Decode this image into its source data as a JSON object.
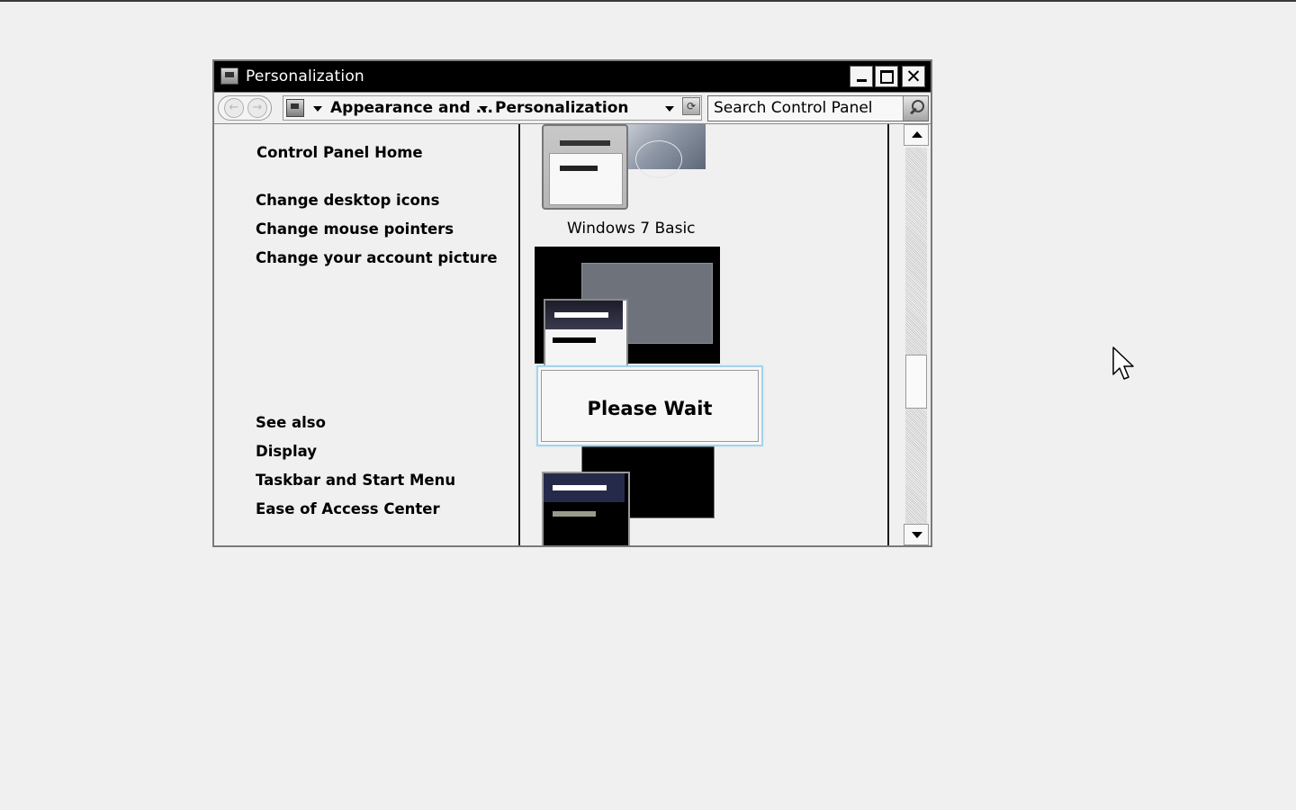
{
  "window": {
    "title": "Personalization"
  },
  "address_bar": {
    "breadcrumb": [
      "Appearance and ...",
      "Personalization"
    ],
    "search_placeholder": "Search Control Panel"
  },
  "left_pane": {
    "home_link": "Control Panel Home",
    "task_links": [
      "Change desktop icons",
      "Change mouse pointers",
      "Change your account picture"
    ],
    "see_also_heading": "See also",
    "see_also_links": [
      "Display",
      "Taskbar and Start Menu",
      "Ease of Access Center"
    ]
  },
  "themes": {
    "visible_label": "Windows 7 Basic"
  },
  "dialog": {
    "message": "Please Wait"
  },
  "colors": {
    "titlebar": "#000000",
    "window_bg": "#f0f0f0",
    "dialog_border": "#a5d4ea"
  },
  "icons": [
    "control-panel-icon",
    "minimize-icon",
    "maximize-icon",
    "close-icon",
    "back-arrow-icon",
    "forward-arrow-icon",
    "dropdown-arrow-icon",
    "refresh-icon",
    "search-icon",
    "scroll-up-arrow-icon",
    "scroll-down-arrow-icon",
    "mouse-cursor-icon"
  ]
}
